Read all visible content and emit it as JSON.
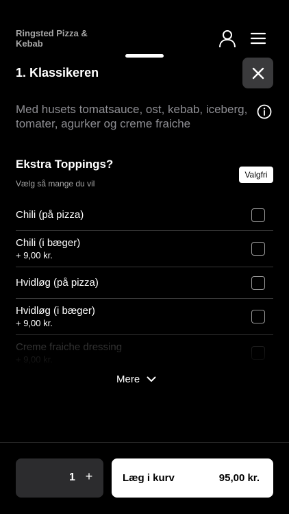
{
  "header": {
    "restaurant_name": "Ringsted Pizza & Kebab",
    "user_icon": "user-icon",
    "menu_icon": "hamburger-menu-icon"
  },
  "product": {
    "title": "1. Klassikeren",
    "description": "Med husets tomatsauce, ost, kebab, iceberg, tomater, agurker og creme fraiche",
    "close_icon": "close-icon",
    "info_icon": "info-icon"
  },
  "group": {
    "title": "Ekstra Toppings?",
    "subtitle": "Vælg så mange du vil",
    "badge": "Valgfri",
    "options": [
      {
        "name": "Chili (på pizza)",
        "price": "",
        "checked": false
      },
      {
        "name": "Chili (i bæger)",
        "price": "+ 9,00 kr.",
        "checked": false
      },
      {
        "name": "Hvidløg (på pizza)",
        "price": "",
        "checked": false
      },
      {
        "name": "Hvidløg (i bæger)",
        "price": "+ 9,00 kr.",
        "checked": false
      },
      {
        "name": "Creme fraiche dressing",
        "price": "+ 9,00 kr.",
        "checked": false
      }
    ],
    "more_label": "Mere"
  },
  "footer": {
    "quantity": "1",
    "plus_label": "+",
    "add_label": "Læg i kurv",
    "total": "95,00 kr."
  },
  "colors": {
    "background": "#000000",
    "surface": "#2c2c2e",
    "muted_text": "#8e8e93"
  }
}
